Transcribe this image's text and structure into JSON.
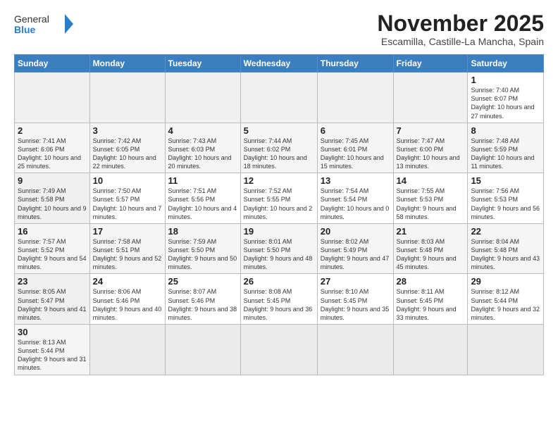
{
  "header": {
    "logo_general": "General",
    "logo_blue": "Blue",
    "month_title": "November 2025",
    "location": "Escamilla, Castille-La Mancha, Spain"
  },
  "days_of_week": [
    "Sunday",
    "Monday",
    "Tuesday",
    "Wednesday",
    "Thursday",
    "Friday",
    "Saturday"
  ],
  "weeks": [
    [
      {
        "day": "",
        "info": "",
        "empty": true
      },
      {
        "day": "",
        "info": "",
        "empty": true
      },
      {
        "day": "",
        "info": "",
        "empty": true
      },
      {
        "day": "",
        "info": "",
        "empty": true
      },
      {
        "day": "",
        "info": "",
        "empty": true
      },
      {
        "day": "",
        "info": "",
        "empty": true
      },
      {
        "day": "1",
        "info": "Sunrise: 7:40 AM\nSunset: 6:07 PM\nDaylight: 10 hours and 27 minutes."
      }
    ],
    [
      {
        "day": "2",
        "info": "Sunrise: 7:41 AM\nSunset: 6:06 PM\nDaylight: 10 hours and 25 minutes."
      },
      {
        "day": "3",
        "info": "Sunrise: 7:42 AM\nSunset: 6:05 PM\nDaylight: 10 hours and 22 minutes."
      },
      {
        "day": "4",
        "info": "Sunrise: 7:43 AM\nSunset: 6:03 PM\nDaylight: 10 hours and 20 minutes."
      },
      {
        "day": "5",
        "info": "Sunrise: 7:44 AM\nSunset: 6:02 PM\nDaylight: 10 hours and 18 minutes."
      },
      {
        "day": "6",
        "info": "Sunrise: 7:45 AM\nSunset: 6:01 PM\nDaylight: 10 hours and 15 minutes."
      },
      {
        "day": "7",
        "info": "Sunrise: 7:47 AM\nSunset: 6:00 PM\nDaylight: 10 hours and 13 minutes."
      },
      {
        "day": "8",
        "info": "Sunrise: 7:48 AM\nSunset: 5:59 PM\nDaylight: 10 hours and 11 minutes."
      }
    ],
    [
      {
        "day": "9",
        "info": "Sunrise: 7:49 AM\nSunset: 5:58 PM\nDaylight: 10 hours and 9 minutes."
      },
      {
        "day": "10",
        "info": "Sunrise: 7:50 AM\nSunset: 5:57 PM\nDaylight: 10 hours and 7 minutes."
      },
      {
        "day": "11",
        "info": "Sunrise: 7:51 AM\nSunset: 5:56 PM\nDaylight: 10 hours and 4 minutes."
      },
      {
        "day": "12",
        "info": "Sunrise: 7:52 AM\nSunset: 5:55 PM\nDaylight: 10 hours and 2 minutes."
      },
      {
        "day": "13",
        "info": "Sunrise: 7:54 AM\nSunset: 5:54 PM\nDaylight: 10 hours and 0 minutes."
      },
      {
        "day": "14",
        "info": "Sunrise: 7:55 AM\nSunset: 5:53 PM\nDaylight: 9 hours and 58 minutes."
      },
      {
        "day": "15",
        "info": "Sunrise: 7:56 AM\nSunset: 5:53 PM\nDaylight: 9 hours and 56 minutes."
      }
    ],
    [
      {
        "day": "16",
        "info": "Sunrise: 7:57 AM\nSunset: 5:52 PM\nDaylight: 9 hours and 54 minutes."
      },
      {
        "day": "17",
        "info": "Sunrise: 7:58 AM\nSunset: 5:51 PM\nDaylight: 9 hours and 52 minutes."
      },
      {
        "day": "18",
        "info": "Sunrise: 7:59 AM\nSunset: 5:50 PM\nDaylight: 9 hours and 50 minutes."
      },
      {
        "day": "19",
        "info": "Sunrise: 8:01 AM\nSunset: 5:50 PM\nDaylight: 9 hours and 48 minutes."
      },
      {
        "day": "20",
        "info": "Sunrise: 8:02 AM\nSunset: 5:49 PM\nDaylight: 9 hours and 47 minutes."
      },
      {
        "day": "21",
        "info": "Sunrise: 8:03 AM\nSunset: 5:48 PM\nDaylight: 9 hours and 45 minutes."
      },
      {
        "day": "22",
        "info": "Sunrise: 8:04 AM\nSunset: 5:48 PM\nDaylight: 9 hours and 43 minutes."
      }
    ],
    [
      {
        "day": "23",
        "info": "Sunrise: 8:05 AM\nSunset: 5:47 PM\nDaylight: 9 hours and 41 minutes."
      },
      {
        "day": "24",
        "info": "Sunrise: 8:06 AM\nSunset: 5:46 PM\nDaylight: 9 hours and 40 minutes."
      },
      {
        "day": "25",
        "info": "Sunrise: 8:07 AM\nSunset: 5:46 PM\nDaylight: 9 hours and 38 minutes."
      },
      {
        "day": "26",
        "info": "Sunrise: 8:08 AM\nSunset: 5:45 PM\nDaylight: 9 hours and 36 minutes."
      },
      {
        "day": "27",
        "info": "Sunrise: 8:10 AM\nSunset: 5:45 PM\nDaylight: 9 hours and 35 minutes."
      },
      {
        "day": "28",
        "info": "Sunrise: 8:11 AM\nSunset: 5:45 PM\nDaylight: 9 hours and 33 minutes."
      },
      {
        "day": "29",
        "info": "Sunrise: 8:12 AM\nSunset: 5:44 PM\nDaylight: 9 hours and 32 minutes."
      }
    ],
    [
      {
        "day": "30",
        "info": "Sunrise: 8:13 AM\nSunset: 5:44 PM\nDaylight: 9 hours and 31 minutes."
      },
      {
        "day": "",
        "info": "",
        "empty": true
      },
      {
        "day": "",
        "info": "",
        "empty": true
      },
      {
        "day": "",
        "info": "",
        "empty": true
      },
      {
        "day": "",
        "info": "",
        "empty": true
      },
      {
        "day": "",
        "info": "",
        "empty": true
      },
      {
        "day": "",
        "info": "",
        "empty": true
      }
    ]
  ]
}
